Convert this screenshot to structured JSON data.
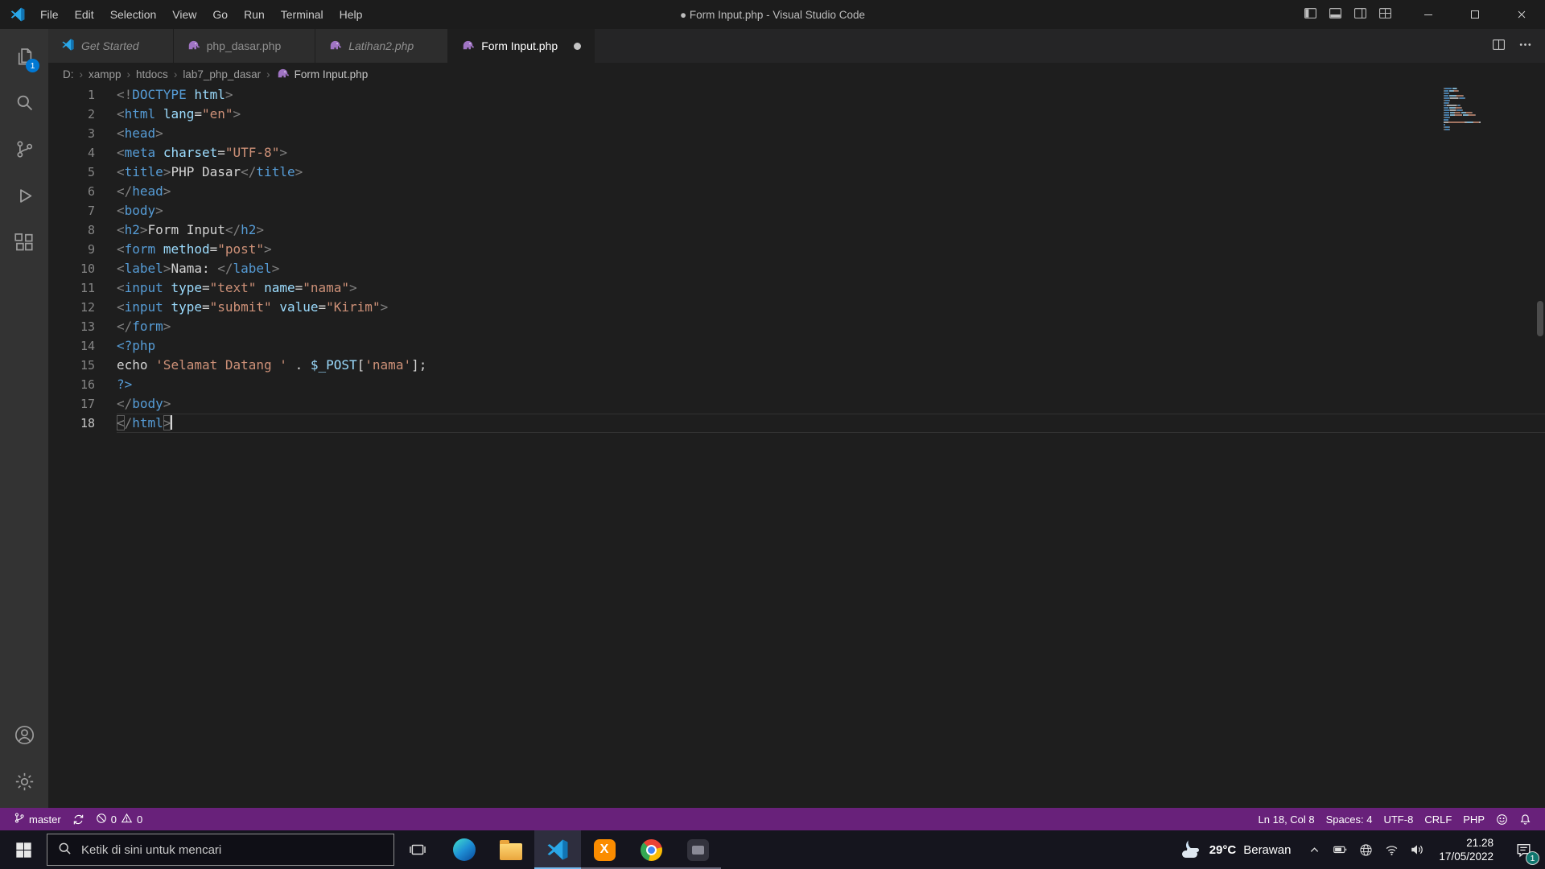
{
  "window": {
    "title": "● Form Input.php - Visual Studio Code",
    "menus": [
      "File",
      "Edit",
      "Selection",
      "View",
      "Go",
      "Run",
      "Terminal",
      "Help"
    ]
  },
  "activity_bar": {
    "items": [
      {
        "name": "explorer",
        "badge": "1"
      },
      {
        "name": "search"
      },
      {
        "name": "source-control"
      },
      {
        "name": "run-debug"
      },
      {
        "name": "extensions"
      }
    ],
    "bottom": [
      {
        "name": "account"
      },
      {
        "name": "settings"
      }
    ]
  },
  "tabs": [
    {
      "label": "Get Started",
      "icon": "vscode",
      "italic": true,
      "active": false,
      "dirty": false
    },
    {
      "label": "php_dasar.php",
      "icon": "php",
      "italic": false,
      "active": false,
      "dirty": false
    },
    {
      "label": "Latihan2.php",
      "icon": "php",
      "italic": true,
      "active": false,
      "dirty": false
    },
    {
      "label": "Form Input.php",
      "icon": "php",
      "italic": false,
      "active": true,
      "dirty": true
    }
  ],
  "breadcrumb": {
    "segments": [
      "D:",
      "xampp",
      "htdocs",
      "lab7_php_dasar"
    ],
    "file": "Form Input.php",
    "file_icon": "php"
  },
  "editor": {
    "cursor_line": 18,
    "lines": [
      {
        "n": 1,
        "tokens": [
          [
            "p",
            "<!"
          ],
          [
            "t",
            "DOCTYPE"
          ],
          [
            "d",
            " "
          ],
          [
            "a",
            "html"
          ],
          [
            "p",
            ">"
          ]
        ]
      },
      {
        "n": 2,
        "tokens": [
          [
            "p",
            "<"
          ],
          [
            "t",
            "html"
          ],
          [
            "d",
            " "
          ],
          [
            "a",
            "lang"
          ],
          [
            "d",
            "="
          ],
          [
            "s",
            "\"en\""
          ],
          [
            "p",
            ">"
          ]
        ]
      },
      {
        "n": 3,
        "tokens": [
          [
            "p",
            "<"
          ],
          [
            "t",
            "head"
          ],
          [
            "p",
            ">"
          ]
        ]
      },
      {
        "n": 4,
        "tokens": [
          [
            "p",
            "<"
          ],
          [
            "t",
            "meta"
          ],
          [
            "d",
            " "
          ],
          [
            "a",
            "charset"
          ],
          [
            "d",
            "="
          ],
          [
            "s",
            "\"UTF-8\""
          ],
          [
            "p",
            ">"
          ]
        ]
      },
      {
        "n": 5,
        "tokens": [
          [
            "p",
            "<"
          ],
          [
            "t",
            "title"
          ],
          [
            "p",
            ">"
          ],
          [
            "d",
            "PHP Dasar"
          ],
          [
            "p",
            "</"
          ],
          [
            "t",
            "title"
          ],
          [
            "p",
            ">"
          ]
        ]
      },
      {
        "n": 6,
        "tokens": [
          [
            "p",
            "</"
          ],
          [
            "t",
            "head"
          ],
          [
            "p",
            ">"
          ]
        ]
      },
      {
        "n": 7,
        "tokens": [
          [
            "p",
            "<"
          ],
          [
            "t",
            "body"
          ],
          [
            "p",
            ">"
          ]
        ]
      },
      {
        "n": 8,
        "tokens": [
          [
            "p",
            "<"
          ],
          [
            "t",
            "h2"
          ],
          [
            "p",
            ">"
          ],
          [
            "d",
            "Form Input"
          ],
          [
            "p",
            "</"
          ],
          [
            "t",
            "h2"
          ],
          [
            "p",
            ">"
          ]
        ]
      },
      {
        "n": 9,
        "tokens": [
          [
            "p",
            "<"
          ],
          [
            "t",
            "form"
          ],
          [
            "d",
            " "
          ],
          [
            "a",
            "method"
          ],
          [
            "d",
            "="
          ],
          [
            "s",
            "\"post\""
          ],
          [
            "p",
            ">"
          ]
        ]
      },
      {
        "n": 10,
        "tokens": [
          [
            "p",
            "<"
          ],
          [
            "t",
            "label"
          ],
          [
            "p",
            ">"
          ],
          [
            "d",
            "Nama: "
          ],
          [
            "p",
            "</"
          ],
          [
            "t",
            "label"
          ],
          [
            "p",
            ">"
          ]
        ]
      },
      {
        "n": 11,
        "tokens": [
          [
            "p",
            "<"
          ],
          [
            "t",
            "input"
          ],
          [
            "d",
            " "
          ],
          [
            "a",
            "type"
          ],
          [
            "d",
            "="
          ],
          [
            "s",
            "\"text\""
          ],
          [
            "d",
            " "
          ],
          [
            "a",
            "name"
          ],
          [
            "d",
            "="
          ],
          [
            "s",
            "\"nama\""
          ],
          [
            "p",
            ">"
          ]
        ]
      },
      {
        "n": 12,
        "tokens": [
          [
            "p",
            "<"
          ],
          [
            "t",
            "input"
          ],
          [
            "d",
            " "
          ],
          [
            "a",
            "type"
          ],
          [
            "d",
            "="
          ],
          [
            "s",
            "\"submit\""
          ],
          [
            "d",
            " "
          ],
          [
            "a",
            "value"
          ],
          [
            "d",
            "="
          ],
          [
            "s",
            "\"Kirim\""
          ],
          [
            "p",
            ">"
          ]
        ]
      },
      {
        "n": 13,
        "tokens": [
          [
            "p",
            "</"
          ],
          [
            "t",
            "form"
          ],
          [
            "p",
            ">"
          ]
        ]
      },
      {
        "n": 14,
        "tokens": [
          [
            "k",
            "<?php"
          ]
        ]
      },
      {
        "n": 15,
        "tokens": [
          [
            "d",
            "echo "
          ],
          [
            "s",
            "'Selamat Datang '"
          ],
          [
            "d",
            " . "
          ],
          [
            "v",
            "$_POST"
          ],
          [
            "d",
            "["
          ],
          [
            "s",
            "'nama'"
          ],
          [
            "d",
            "];"
          ]
        ]
      },
      {
        "n": 16,
        "tokens": [
          [
            "k",
            "?>"
          ]
        ]
      },
      {
        "n": 17,
        "tokens": [
          [
            "p",
            "</"
          ],
          [
            "t",
            "body"
          ],
          [
            "p",
            ">"
          ]
        ]
      },
      {
        "n": 18,
        "tokens": [
          [
            "pb",
            "<"
          ],
          [
            "p",
            "/"
          ],
          [
            "t",
            "html"
          ],
          [
            "pb",
            ">"
          ]
        ]
      }
    ]
  },
  "status_bar": {
    "branch": "master",
    "errors": "0",
    "warnings": "0",
    "items_right": [
      "Ln 18, Col 8",
      "Spaces: 4",
      "UTF-8",
      "CRLF",
      "PHP"
    ]
  },
  "taskbar": {
    "search_placeholder": "Ketik di sini untuk mencari",
    "apps": [
      {
        "name": "edge",
        "state": "pinned"
      },
      {
        "name": "file-explorer",
        "state": "pinned"
      },
      {
        "name": "vscode",
        "state": "active"
      },
      {
        "name": "xampp",
        "state": "running"
      },
      {
        "name": "chrome",
        "state": "running"
      },
      {
        "name": "app-dark",
        "state": "running"
      }
    ],
    "weather_temp": "29°C",
    "weather_desc": "Berawan",
    "time": "21.28",
    "date": "17/05/2022",
    "notification_badge": "1"
  },
  "colors": {
    "accent_blue": "#569cd6",
    "statusbar_purple": "#68217A",
    "badge_blue": "#0078d4"
  }
}
